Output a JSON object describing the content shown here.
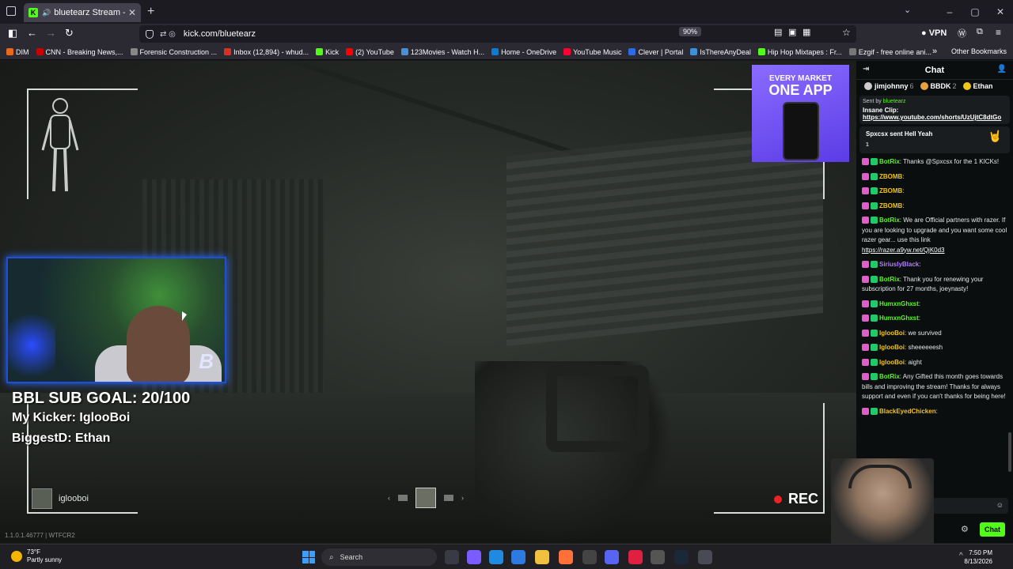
{
  "browser": {
    "tab_title": "bluetearz Stream - Watch L",
    "tab_close": "✕",
    "new_tab": "+",
    "url": "kick.com/bluetearz",
    "zoom": "90%",
    "vpn": "VPN",
    "window_min": "–",
    "window_max": "▢",
    "window_close": "✕"
  },
  "bookmarks": [
    {
      "label": "DIM",
      "color": "#e86a1a"
    },
    {
      "label": "CNN - Breaking News,...",
      "color": "#cc0000"
    },
    {
      "label": "Forensic Construction ...",
      "color": "#888888"
    },
    {
      "label": "Inbox (12,894) - whud...",
      "color": "#d93025"
    },
    {
      "label": "Kick",
      "color": "#53fc18"
    },
    {
      "label": "(2) YouTube",
      "color": "#ff0000"
    },
    {
      "label": "123Movies - Watch H...",
      "color": "#4a90d9"
    },
    {
      "label": "Home - OneDrive",
      "color": "#0a7cd6"
    },
    {
      "label": "YouTube Music",
      "color": "#ff0033"
    },
    {
      "label": "Clever | Portal",
      "color": "#2c6ae6"
    },
    {
      "label": "IsThereAnyDeal",
      "color": "#3d8fd6"
    },
    {
      "label": "Hip Hop Mixtapes : Fr...",
      "color": "#53fc18"
    },
    {
      "label": "Ezgif - free online ani...",
      "color": "#777777"
    }
  ],
  "bookmarks_other": "Other Bookmarks",
  "stream": {
    "sub_goal": "BBL SUB GOAL: 20/100",
    "kicker": "My Kicker: IglooBoi",
    "biggest": "BiggestD: Ethan",
    "player_name": "iglooboi",
    "rec": "REC",
    "version": "1.1.0.1.46777 | WTFCR2",
    "ad_line1": "EVERY MARKET",
    "ad_line2": "ONE APP"
  },
  "chat": {
    "title": "Chat",
    "gifters": [
      {
        "name": "jimjohnny",
        "count": "6",
        "color": "#cccccc"
      },
      {
        "name": "BBDK",
        "count": "2",
        "color": "#e8a33a"
      },
      {
        "name": "Ethan",
        "count": "",
        "color": "#f0c419"
      }
    ],
    "pinned_sent_by": "Sent by",
    "pinned_sender": "bluetearz",
    "pinned_label": "Insane Clip:",
    "pinned_link": "https://www.youtube.com/shorts/UzUjtC8dtGo",
    "kick_alert": "Spxcsx sent Hell Yeah",
    "kick_alert_count": "1",
    "messages": [
      {
        "user": "BotRix",
        "color": "#53fc18",
        "text": ": Thanks @Spxcsx for the 1 KICKs!"
      },
      {
        "user": "ZBOMB",
        "color": "#f0c419",
        "text": ":"
      },
      {
        "user": "ZBOMB",
        "color": "#f0c419",
        "text": ":"
      },
      {
        "user": "ZBOMB",
        "color": "#f0c419",
        "text": ":"
      },
      {
        "user": "BotRix",
        "color": "#53fc18",
        "text": ": We are Official partners with razer. If you are looking to upgrade and you want some cool razer gear... use this link ",
        "link": "https://razer.a9yw.net/QjK0d3"
      },
      {
        "user": "SiriuslyBlack",
        "color": "#b07cff",
        "text": ":"
      },
      {
        "user": "BotRix",
        "color": "#53fc18",
        "text": ": Thank you for renewing your subscription for 27 months, joeynasty!"
      },
      {
        "user": "HumxnGhxst",
        "color": "#53fc18",
        "text": ":"
      },
      {
        "user": "HumxnGhxst",
        "color": "#53fc18",
        "text": ":"
      },
      {
        "user": "IglooBoi",
        "color": "#f0c419",
        "text": ": we survived"
      },
      {
        "user": "IglooBoi",
        "color": "#f0c419",
        "text": ": sheeeeeesh"
      },
      {
        "user": "IglooBoi",
        "color": "#f0c419",
        "text": ": aight"
      },
      {
        "user": "BotRix",
        "color": "#53fc18",
        "text": ": Any Gifted this month goes towards bills and improving the stream! Thanks for always support and even if you can't thanks for being here!"
      },
      {
        "user": "BlackEyedChicken",
        "color": "#f0c419",
        "text": ":"
      }
    ],
    "send_label": "Chat"
  },
  "taskbar": {
    "temp": "73°F",
    "weather": "Partly sunny",
    "search": "Search",
    "time": "7:50 PM",
    "date": "8/13/2026"
  }
}
